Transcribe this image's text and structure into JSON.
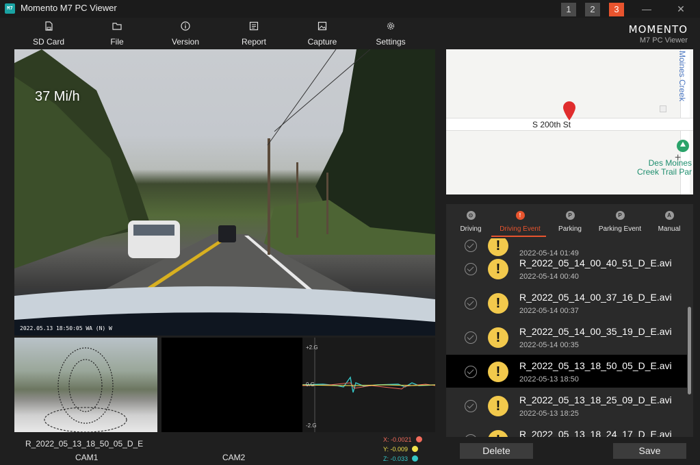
{
  "app": {
    "title": "Momento M7 PC Viewer",
    "logo_text": "M7",
    "cam_buttons": [
      "1",
      "2",
      "3"
    ],
    "active_cam": "3",
    "minimize": "—",
    "close": "✕"
  },
  "toolbar": {
    "items": [
      {
        "label": "SD Card",
        "icon": "sd-card-icon"
      },
      {
        "label": "File",
        "icon": "folder-icon"
      },
      {
        "label": "Version",
        "icon": "info-icon"
      },
      {
        "label": "Report",
        "icon": "report-icon"
      },
      {
        "label": "Capture",
        "icon": "image-icon"
      },
      {
        "label": "Settings",
        "icon": "gear-icon"
      }
    ]
  },
  "brand": {
    "wordmark": "MOMENTO",
    "subtitle": "M7 PC Viewer"
  },
  "video": {
    "speed": "37 Mi/h",
    "timestamp": "2022.05.13  18:50:05  WA  (N)  W"
  },
  "playback": {
    "filename": "R_2022_05_13_18_50_05_D_E",
    "cam1_label": "CAM1",
    "cam2_label": "CAM2"
  },
  "gsensor": {
    "top_label": "+2.G",
    "mid_label": "0.G",
    "bottom_label": "-2.G",
    "x_readout": "X: -0.0021",
    "y_readout": "Y: -0.009",
    "z_readout": "Z: -0.033",
    "colors": {
      "x": "#f26b5b",
      "y": "#f2e24c",
      "z": "#35c6c6"
    }
  },
  "map": {
    "street": "S 200th St",
    "creek_line1": "Des Moines",
    "creek_line2": "Creek Trail Par",
    "moines_label": "Moines Creek",
    "zoom_in": "+"
  },
  "tabs": [
    {
      "label": "Driving",
      "icon": "driving-icon",
      "glyph": "⊙"
    },
    {
      "label": "Driving Event",
      "icon": "alert-icon",
      "glyph": "!"
    },
    {
      "label": "Parking",
      "icon": "parking-icon",
      "glyph": "P"
    },
    {
      "label": "Parking Event",
      "icon": "parking-event-icon",
      "glyph": "P"
    },
    {
      "label": "Manual",
      "icon": "manual-icon",
      "glyph": "A"
    }
  ],
  "active_tab": "Driving Event",
  "files": [
    {
      "name": "",
      "date": "2022-05-14 01:49"
    },
    {
      "name": "R_2022_05_14_00_40_51_D_E.avi",
      "date": "2022-05-14 00:40"
    },
    {
      "name": "R_2022_05_14_00_37_16_D_E.avi",
      "date": "2022-05-14 00:37"
    },
    {
      "name": "R_2022_05_14_00_35_19_D_E.avi",
      "date": "2022-05-14 00:35"
    },
    {
      "name": "R_2022_05_13_18_50_05_D_E.avi",
      "date": "2022-05-13 18:50"
    },
    {
      "name": "R_2022_05_13_18_25_09_D_E.avi",
      "date": "2022-05-13 18:25"
    },
    {
      "name": "R_2022_05_13_18_24_17_D_E.avi",
      "date": ""
    }
  ],
  "selected_file": "R_2022_05_13_18_50_05_D_E.avi",
  "buttons": {
    "delete": "Delete",
    "save": "Save"
  },
  "colors": {
    "accent": "#e8542e",
    "warning": "#f2c94c"
  }
}
